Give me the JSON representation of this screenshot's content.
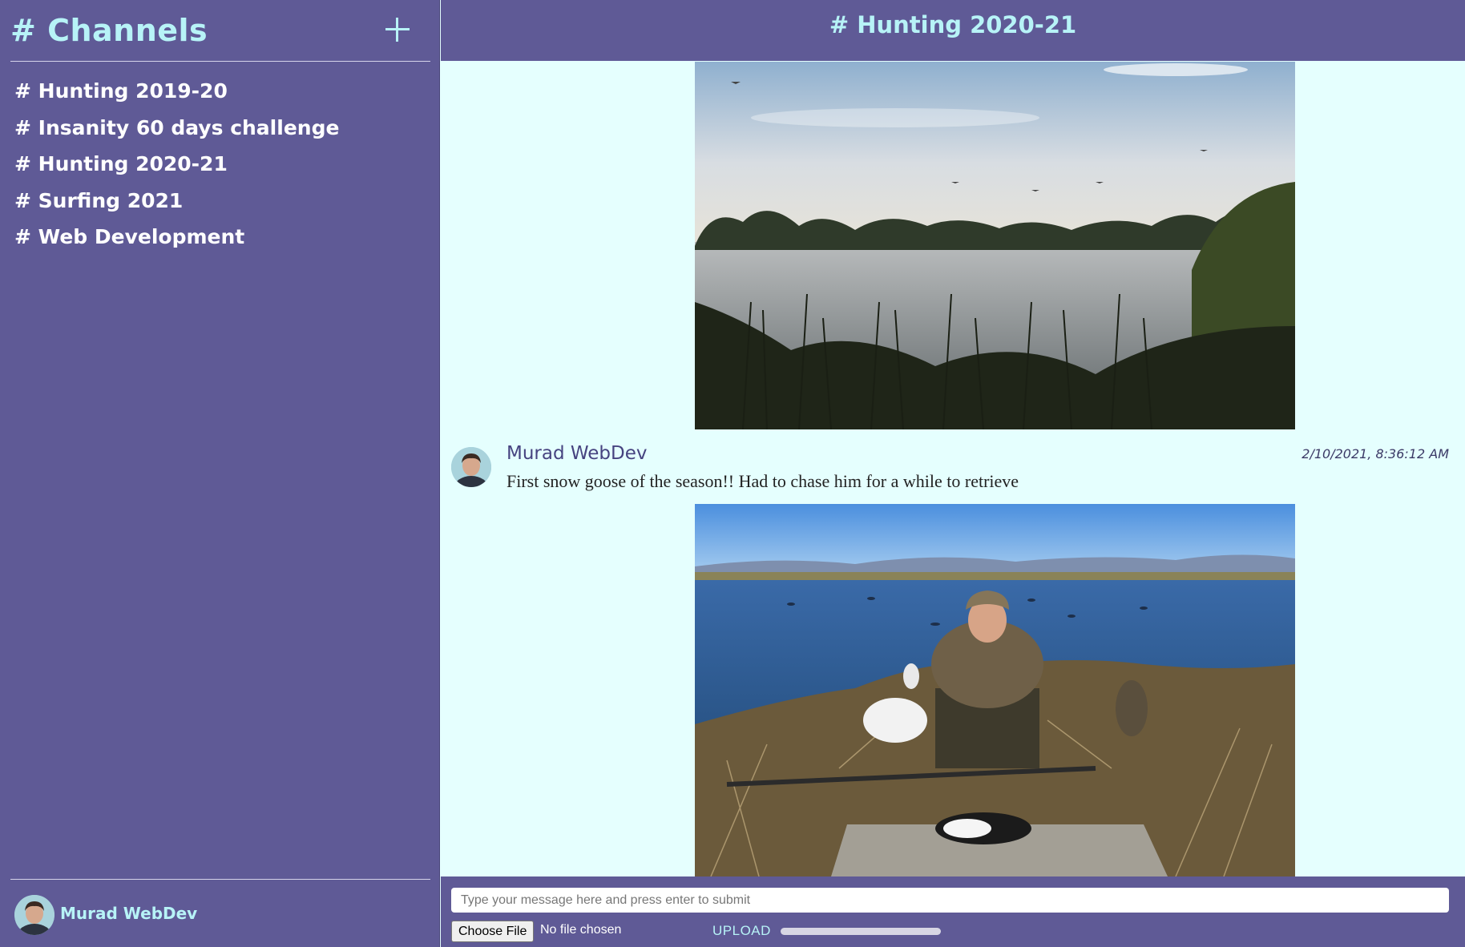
{
  "sidebar": {
    "title": "# Channels",
    "add_icon": "plus-icon",
    "channels": [
      {
        "label": "# Hunting 2019-20"
      },
      {
        "label": "# Insanity 60 days challenge"
      },
      {
        "label": "# Hunting 2020-21"
      },
      {
        "label": "# Surfing 2021"
      },
      {
        "label": "# Web Development"
      }
    ],
    "current_user": {
      "name": "Murad WebDev",
      "avatar": "user-avatar"
    }
  },
  "header": {
    "title": "# Hunting 2020-21"
  },
  "messages": [
    {
      "author": "Murad WebDev",
      "timestamp": "2/10/2021, 8:36:12 AM",
      "text": "First snow goose of the season!! Had to chase him for a while to retrieve"
    }
  ],
  "composer": {
    "placeholder": "Type your message here and press enter to submit",
    "file_button": "Choose File",
    "file_status": "No file chosen",
    "upload_label": "UPLOAD",
    "upload_progress": 0
  },
  "colors": {
    "sidebar_bg": "#5f5a96",
    "accent": "#b7f3f7",
    "chat_bg": "#e5fffe"
  }
}
